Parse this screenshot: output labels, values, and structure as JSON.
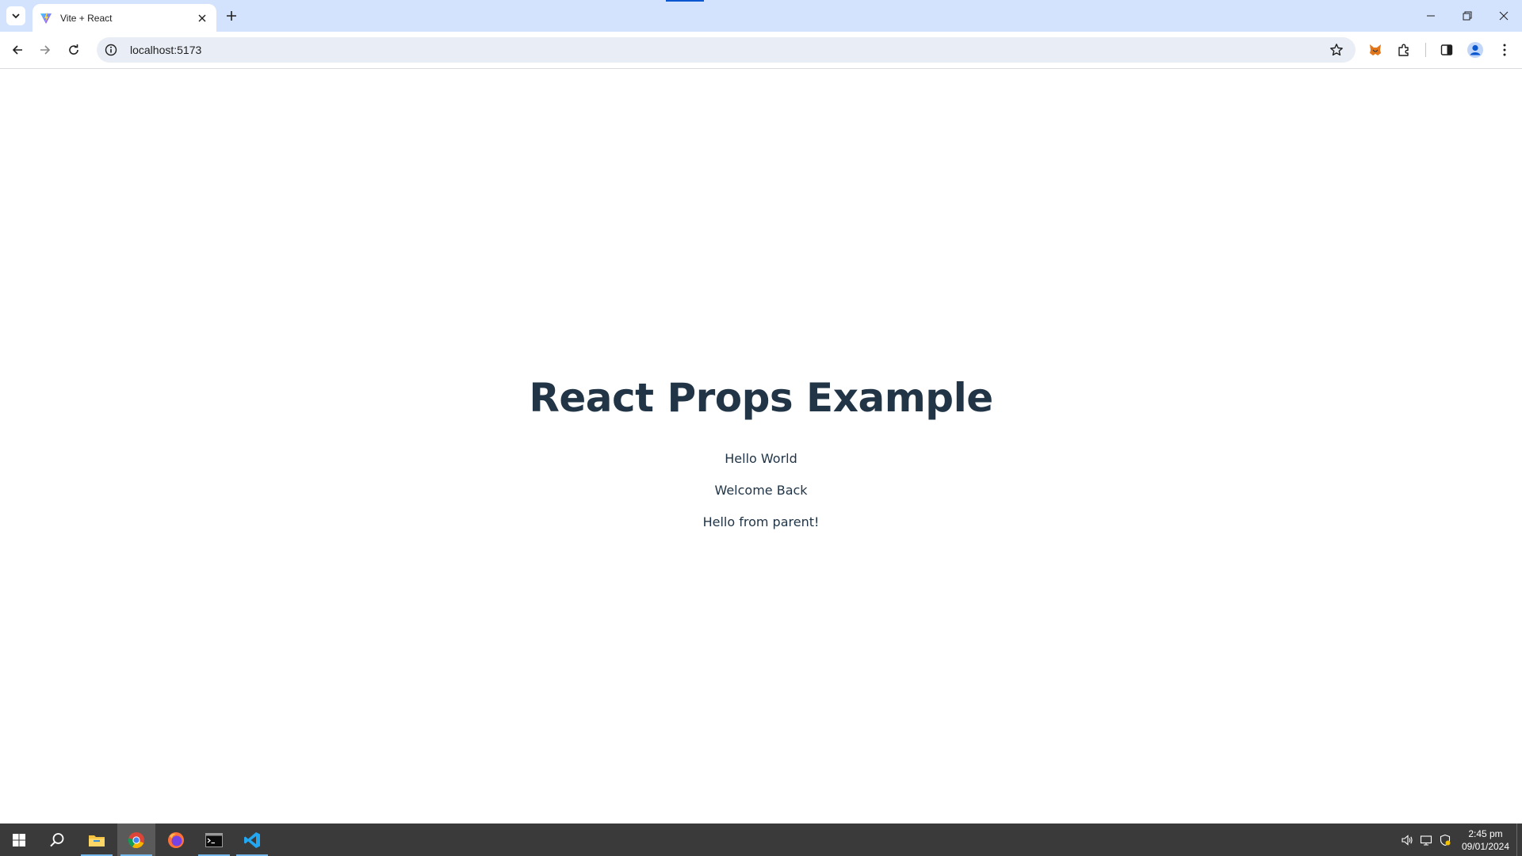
{
  "browser": {
    "tab": {
      "title": "Vite + React",
      "favicon": "vite-logo-icon"
    },
    "address_bar": {
      "url": "localhost:5173"
    },
    "colors": {
      "tabstrip_bg": "#d3e3fd",
      "omnibox_bg": "#e9eef6",
      "accent": "#0b57d0"
    }
  },
  "page": {
    "heading": "React Props Example",
    "greetings": [
      "Hello World",
      "Welcome Back",
      "Hello from parent!"
    ],
    "text_color": "#213547"
  },
  "taskbar": {
    "apps": [
      "start-icon",
      "search-icon",
      "file-explorer-icon",
      "chrome-icon",
      "firefox-icon",
      "terminal-icon",
      "vscode-icon"
    ],
    "clock": {
      "time": "2:45 pm",
      "date": "09/01/2024"
    }
  }
}
